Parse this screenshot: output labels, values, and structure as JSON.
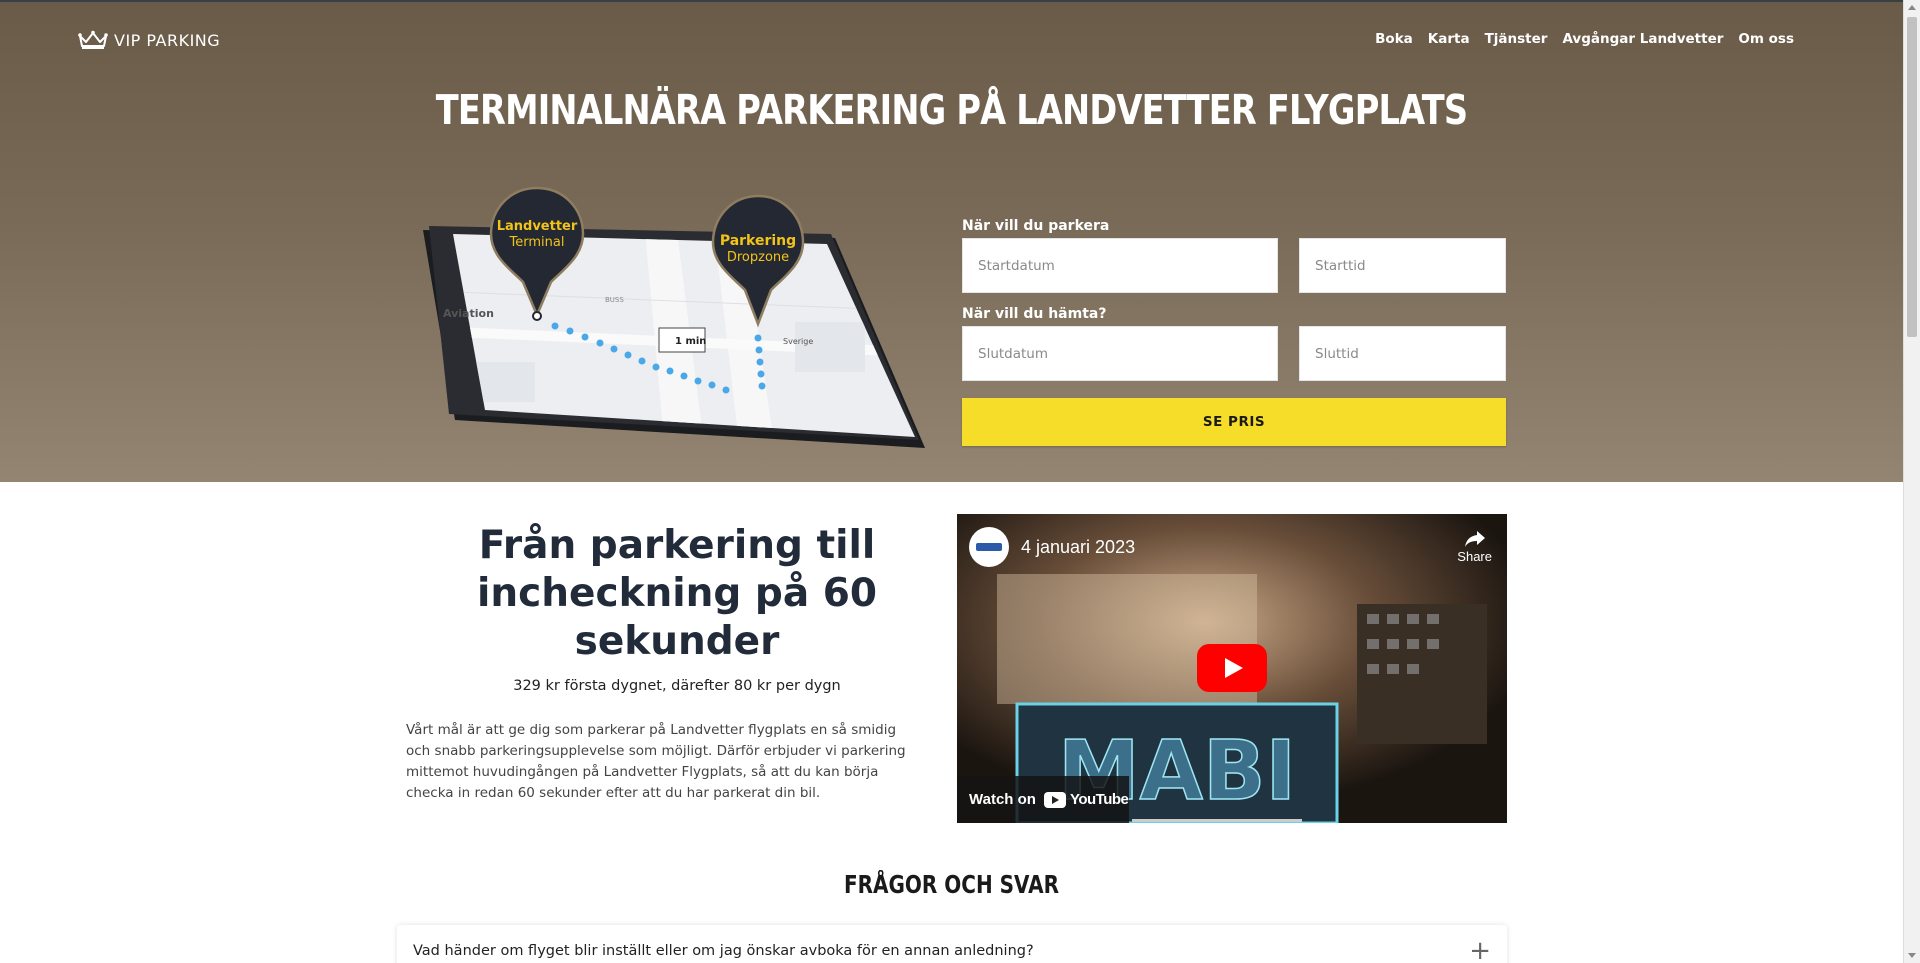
{
  "header": {
    "logo_text": "VIP PARKING",
    "nav": [
      {
        "label": "Boka"
      },
      {
        "label": "Karta"
      },
      {
        "label": "Tjänster"
      },
      {
        "label": "Avgångar Landvetter"
      },
      {
        "label": "Om oss"
      }
    ]
  },
  "hero": {
    "title": "TERMINALNÄRA PARKERING PÅ LANDVETTER FLYGPLATS",
    "map": {
      "pin1_line1": "Landvetter",
      "pin1_line2": "Terminal",
      "pin2_line1": "Parkering",
      "pin2_line2": "Dropzone",
      "walk_time": "1 min",
      "street1": "Aviation",
      "street2": "Sverige",
      "bus_label": "BUSS"
    }
  },
  "form": {
    "park_label": "När vill du parkera",
    "start_date_placeholder": "Startdatum",
    "start_time_placeholder": "Starttid",
    "pickup_label": "När vill du hämta?",
    "end_date_placeholder": "Slutdatum",
    "end_time_placeholder": "Sluttid",
    "submit_label": "SE PRIS"
  },
  "intro": {
    "heading": "Från parkering till incheckning på 60 sekunder",
    "price": "329 kr första dygnet, därefter 80 kr per dygn",
    "description": "Vårt mål är att ge dig som parkerar på Landvetter flygplats en så smidig och snabb parkeringsupplevelse som möjligt. Därför erbjuder vi parkering mittemot huvudingången på Landvetter Flygplats, så att du kan börja checka in redan 60 sekunder efter att du har parkerat din bil."
  },
  "video": {
    "title": "4 januari 2023",
    "share_label": "Share",
    "watch_on": "Watch on",
    "youtube_label": "YouTube",
    "sign_text": "MABI"
  },
  "faq": {
    "title": "FRÅGOR OCH SVAR",
    "items": [
      {
        "question": "Vad händer om flyget blir inställt eller om jag önskar avboka för en annan anledning?",
        "toggle": "+"
      }
    ]
  },
  "colors": {
    "hero_top": "#6a5b48",
    "hero_bottom": "#938571",
    "cta_yellow": "#f6dd2a",
    "pin_dark": "#232833",
    "pin_text": "#f2c418",
    "heading_navy": "#222b3a"
  }
}
